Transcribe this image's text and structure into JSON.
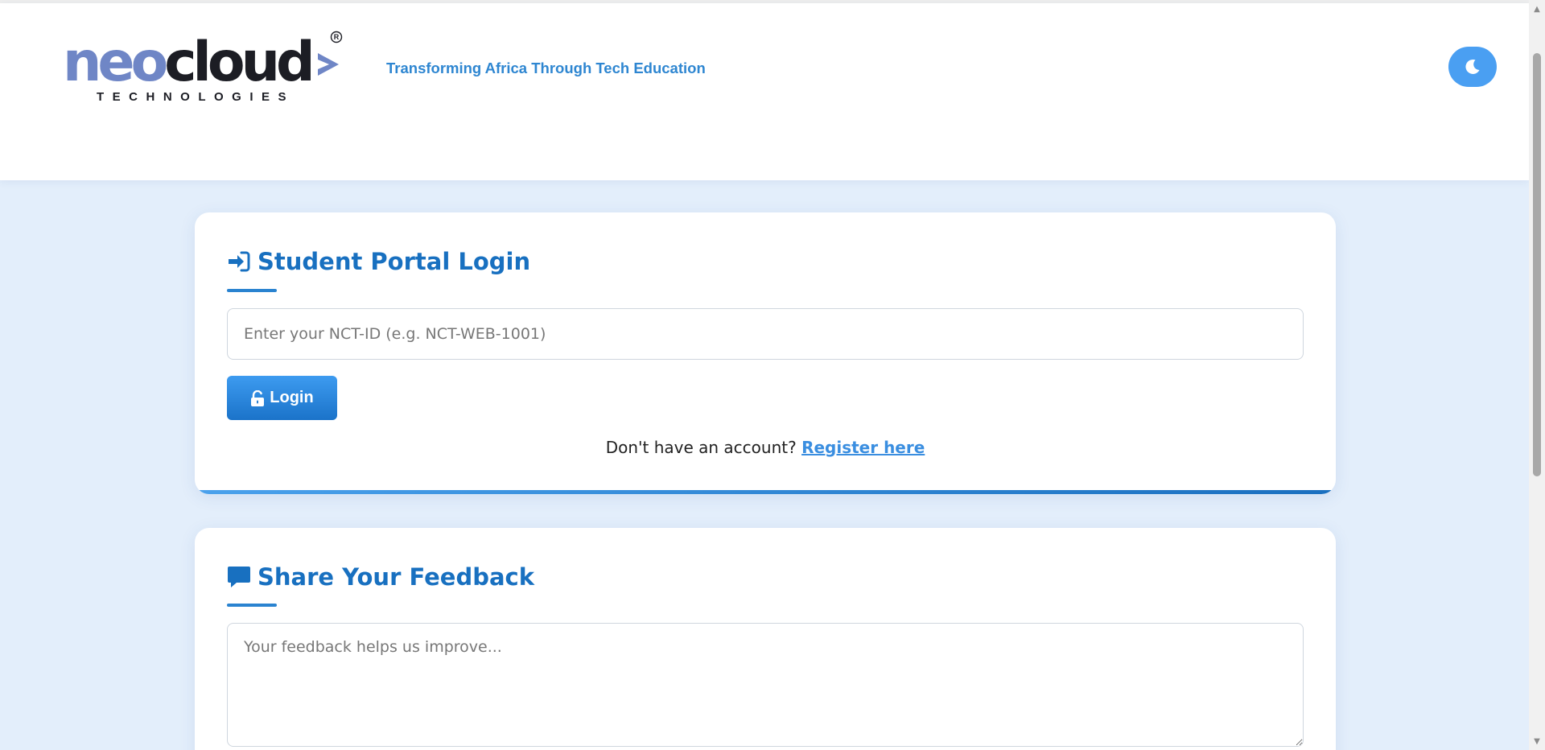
{
  "header": {
    "logo": {
      "primary_a": "neo",
      "primary_b": "cloud",
      "secondary": "TECHNOLOGIES",
      "mark": "®"
    },
    "tagline": "Transforming Africa Through Tech Education",
    "theme_toggle_icon": "moon-icon"
  },
  "login_card": {
    "title": "Student Portal Login",
    "title_icon": "sign-in-icon",
    "input_placeholder": "Enter your NCT-ID (e.g. NCT-WEB-1001)",
    "login_label": "Login",
    "login_icon": "unlock-icon",
    "register_prompt": "Don't have an account?",
    "register_link": "Register here"
  },
  "feedback_card": {
    "title": "Share Your Feedback",
    "title_icon": "comment-icon",
    "textarea_placeholder": "Your feedback helps us improve..."
  },
  "colors": {
    "accent": "#1870c0",
    "page_background": "#e3eefb",
    "tagline": "#2e86d1",
    "logo_neo": "#6f86c6",
    "logo_cloud": "#1c1d24"
  }
}
